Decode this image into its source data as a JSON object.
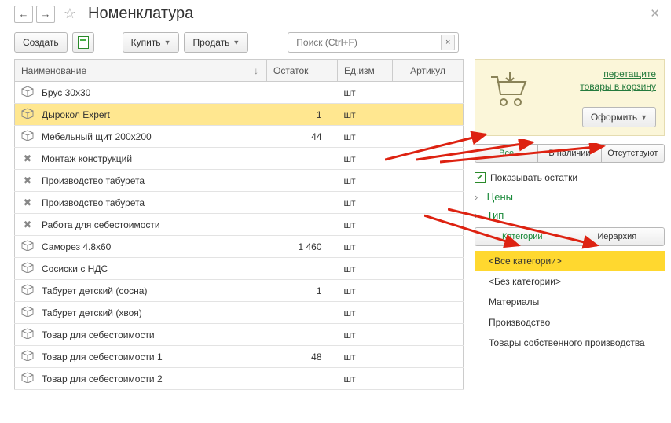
{
  "header": {
    "title": "Номенклатура"
  },
  "toolbar": {
    "create": "Создать",
    "buy": "Купить",
    "sell": "Продать",
    "search_placeholder": "Поиск (Ctrl+F)"
  },
  "columns": {
    "name": "Наименование",
    "stock": "Остаток",
    "unit": "Ед.изм",
    "article": "Артикул"
  },
  "rows": [
    {
      "icon": "box",
      "name": "Брус 30х30",
      "stock": "",
      "unit": "шт",
      "selected": false
    },
    {
      "icon": "box",
      "name": "Дырокол Expert",
      "stock": "1",
      "unit": "шт",
      "selected": true
    },
    {
      "icon": "box",
      "name": "Мебельный щит 200х200",
      "stock": "44",
      "unit": "шт",
      "selected": false
    },
    {
      "icon": "tools",
      "name": "Монтаж конструкций",
      "stock": "",
      "unit": "шт",
      "selected": false
    },
    {
      "icon": "tools",
      "name": "Производство табурета",
      "stock": "",
      "unit": "шт",
      "selected": false
    },
    {
      "icon": "tools",
      "name": "Производство табурета",
      "stock": "",
      "unit": "шт",
      "selected": false
    },
    {
      "icon": "tools",
      "name": "Работа для себестоимости",
      "stock": "",
      "unit": "шт",
      "selected": false
    },
    {
      "icon": "box",
      "name": "Саморез 4.8х60",
      "stock": "1 460",
      "unit": "шт",
      "selected": false
    },
    {
      "icon": "box",
      "name": "Сосиски с НДС",
      "stock": "",
      "unit": "шт",
      "selected": false
    },
    {
      "icon": "box",
      "name": "Табурет детский (сосна)",
      "stock": "1",
      "unit": "шт",
      "selected": false
    },
    {
      "icon": "box",
      "name": "Табурет детский (хвоя)",
      "stock": "",
      "unit": "шт",
      "selected": false
    },
    {
      "icon": "box",
      "name": "Товар для себестоимости",
      "stock": "",
      "unit": "шт",
      "selected": false
    },
    {
      "icon": "box",
      "name": "Товар для себестоимости 1",
      "stock": "48",
      "unit": "шт",
      "selected": false
    },
    {
      "icon": "box",
      "name": "Товар для себестоимости 2",
      "stock": "",
      "unit": "шт",
      "selected": false
    }
  ],
  "cart": {
    "hint_line1": "перетащите",
    "hint_line2": "товары в корзину",
    "submit": "Оформить"
  },
  "filters": {
    "all": "Все",
    "in_stock": "В наличии",
    "out": "Отсутствуют",
    "show_stock": "Показывать остатки",
    "prices": "Цены",
    "type": "Тип"
  },
  "catTabs": {
    "categories": "Категории",
    "hierarchy": "Иерархия"
  },
  "categories": [
    {
      "label": "<Все категории>",
      "selected": true
    },
    {
      "label": "<Без категории>",
      "selected": false
    },
    {
      "label": "Материалы",
      "selected": false
    },
    {
      "label": "Производство",
      "selected": false
    },
    {
      "label": "Товары собственного производства",
      "selected": false
    }
  ]
}
